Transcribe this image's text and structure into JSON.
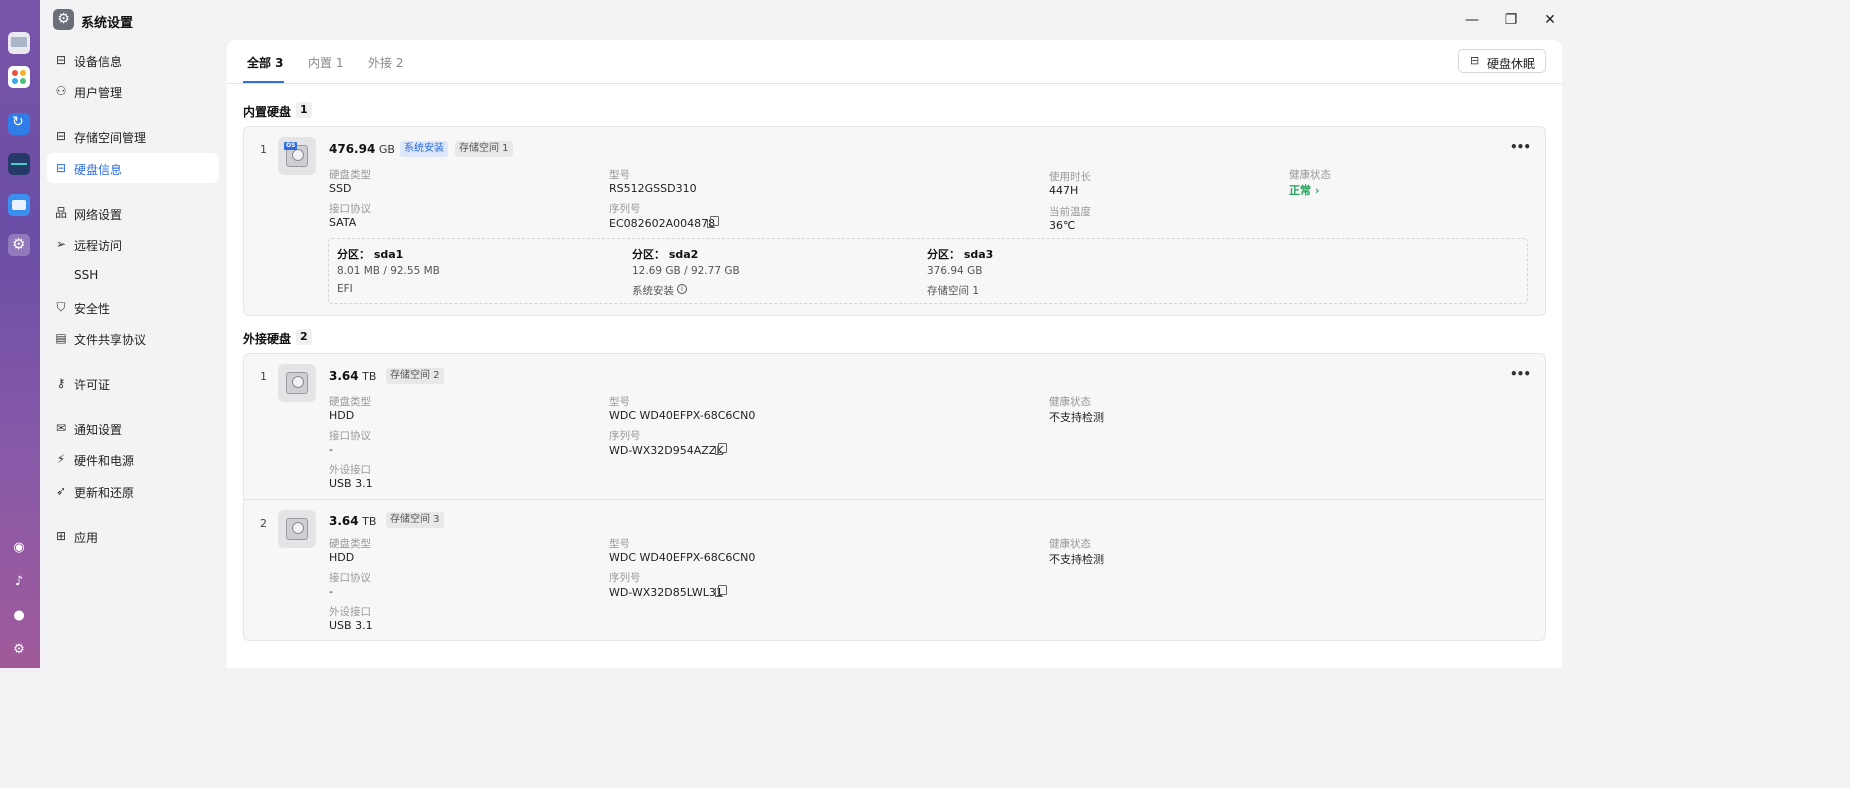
{
  "window": {
    "title": "系统设置"
  },
  "sidebar": {
    "items": [
      {
        "label": "设备信息"
      },
      {
        "label": "用户管理"
      },
      {
        "label": "存储空间管理"
      },
      {
        "label": "硬盘信息"
      },
      {
        "label": "网络设置"
      },
      {
        "label": "远程访问"
      },
      {
        "label": "SSH"
      },
      {
        "label": "安全性"
      },
      {
        "label": "文件共享协议"
      },
      {
        "label": "许可证"
      },
      {
        "label": "通知设置"
      },
      {
        "label": "硬件和电源"
      },
      {
        "label": "更新和还原"
      },
      {
        "label": "应用"
      }
    ],
    "active_index": 3
  },
  "tabs": [
    {
      "label": "全部 3"
    },
    {
      "label": "内置 1"
    },
    {
      "label": "外接 2"
    }
  ],
  "toolbar": {
    "sleep_label": "硬盘休眠"
  },
  "internal": {
    "title": "内置硬盘",
    "count": "1",
    "disks": [
      {
        "index": "1",
        "capacity": "476.94",
        "unit": "GB",
        "tags": [
          "系统安装",
          "存储空间 1"
        ],
        "disk_type_label": "硬盘类型",
        "disk_type": "SSD",
        "protocol_label": "接口协议",
        "protocol": "SATA",
        "model_label": "型号",
        "model": "RS512GSSD310",
        "serial_label": "序列号",
        "serial": "EC082602A004878",
        "uptime_label": "使用时长",
        "uptime": "447H",
        "temp_label": "当前温度",
        "temp": "36℃",
        "health_label": "健康状态",
        "health": "正常",
        "partitions": [
          {
            "name": "分区： sda1",
            "usage": "8.01 MB / 92.55 MB",
            "purpose": "EFI"
          },
          {
            "name": "分区： sda2",
            "usage": "12.69 GB / 92.77 GB",
            "purpose": "系统安装"
          },
          {
            "name": "分区： sda3",
            "usage": "376.94 GB",
            "purpose": "存储空间 1"
          }
        ]
      }
    ]
  },
  "external": {
    "title": "外接硬盘",
    "count": "2",
    "disks": [
      {
        "index": "1",
        "capacity": "3.64",
        "unit": "TB",
        "tag": "存储空间 2",
        "disk_type_label": "硬盘类型",
        "disk_type": "HDD",
        "protocol_label": "接口协议",
        "protocol": "-",
        "port_label": "外设接口",
        "port": "USB 3.1",
        "model_label": "型号",
        "model": "WDC WD40EFPX-68C6CN0",
        "serial_label": "序列号",
        "serial": "WD-WX32D954AZZK",
        "health_label": "健康状态",
        "health": "不支持检测"
      },
      {
        "index": "2",
        "capacity": "3.64",
        "unit": "TB",
        "tag": "存储空间 3",
        "disk_type_label": "硬盘类型",
        "disk_type": "HDD",
        "protocol_label": "接口协议",
        "protocol": "-",
        "port_label": "外设接口",
        "port": "USB 3.1",
        "model_label": "型号",
        "model": "WDC WD40EFPX-68C6CN0",
        "serial_label": "序列号",
        "serial": "WD-WX32D85LWL31",
        "health_label": "健康状态",
        "health": "不支持检测"
      }
    ]
  },
  "colors": {
    "accent": "#2e6cdf",
    "healthy": "#21a35a",
    "dock": "#7a54a8"
  },
  "icons": {
    "dock": [
      "monitor-icon",
      "apps-grid-icon",
      "sync-icon",
      "monitor-graph-icon",
      "file-manager-icon",
      "settings-icon",
      "network-icon",
      "bell-icon",
      "user-icon",
      "gear-icon"
    ]
  }
}
